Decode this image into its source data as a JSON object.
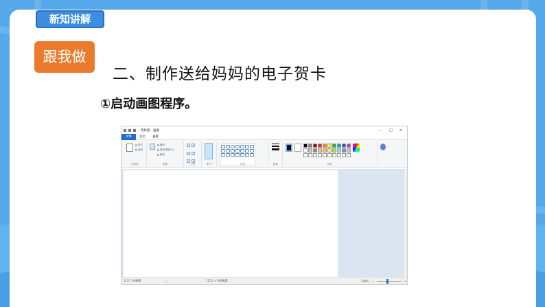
{
  "slide": {
    "tag": "新知讲解",
    "follow_button": "跟我做",
    "heading": "二、制作送给妈妈的电子贺卡",
    "step": "①启动画图程序。"
  },
  "paint_window": {
    "title": "无标题 - 画图",
    "window_controls": [
      "—",
      "□",
      "✕"
    ],
    "menu_tabs": [
      "文件",
      "主页",
      "查看"
    ],
    "groups": {
      "clipboard": {
        "label": "剪贴板",
        "paste": "粘贴",
        "cut": "剪切",
        "copy": "复制"
      },
      "image": {
        "label": "图像",
        "select": "选择",
        "crop": "裁剪",
        "resize": "重新调整大小",
        "rotate": "旋转"
      },
      "tools": {
        "label": "工具"
      },
      "brushes": {
        "label": "刷子"
      },
      "shapes": {
        "label": "形状"
      },
      "size": {
        "label": "粗细"
      },
      "colors": {
        "label": "颜色",
        "color1": "颜色1",
        "color2": "颜色2",
        "edit_colors": "编辑颜色"
      },
      "paint3d": {
        "label": "使用画图3D进行编辑"
      }
    },
    "palette": [
      "#000000",
      "#7f7f7f",
      "#880015",
      "#ed1c24",
      "#ff7f27",
      "#fff200",
      "#22b14c",
      "#00a2e8",
      "#3f48cc",
      "#a349a4",
      "#ffffff",
      "#c3c3c3",
      "#b97a57",
      "#ffaec9",
      "#ffc90e",
      "#efe4b0",
      "#b5e61d",
      "#99d9ea",
      "#7092be",
      "#c8bfe7",
      "#ffffff",
      "#ffffff",
      "#ffffff",
      "#ffffff",
      "#ffffff",
      "#ffffff",
      "#ffffff",
      "#ffffff",
      "#ffffff",
      "#ffffff"
    ],
    "status": {
      "position": "1127, 66像素",
      "size": "1152 × 648像素",
      "zoom": "100%"
    }
  },
  "colors": {
    "accent_orange": "#ec7a2d",
    "tag_blue": "#3d8ee0",
    "file_tab_blue": "#1e6fc8"
  }
}
